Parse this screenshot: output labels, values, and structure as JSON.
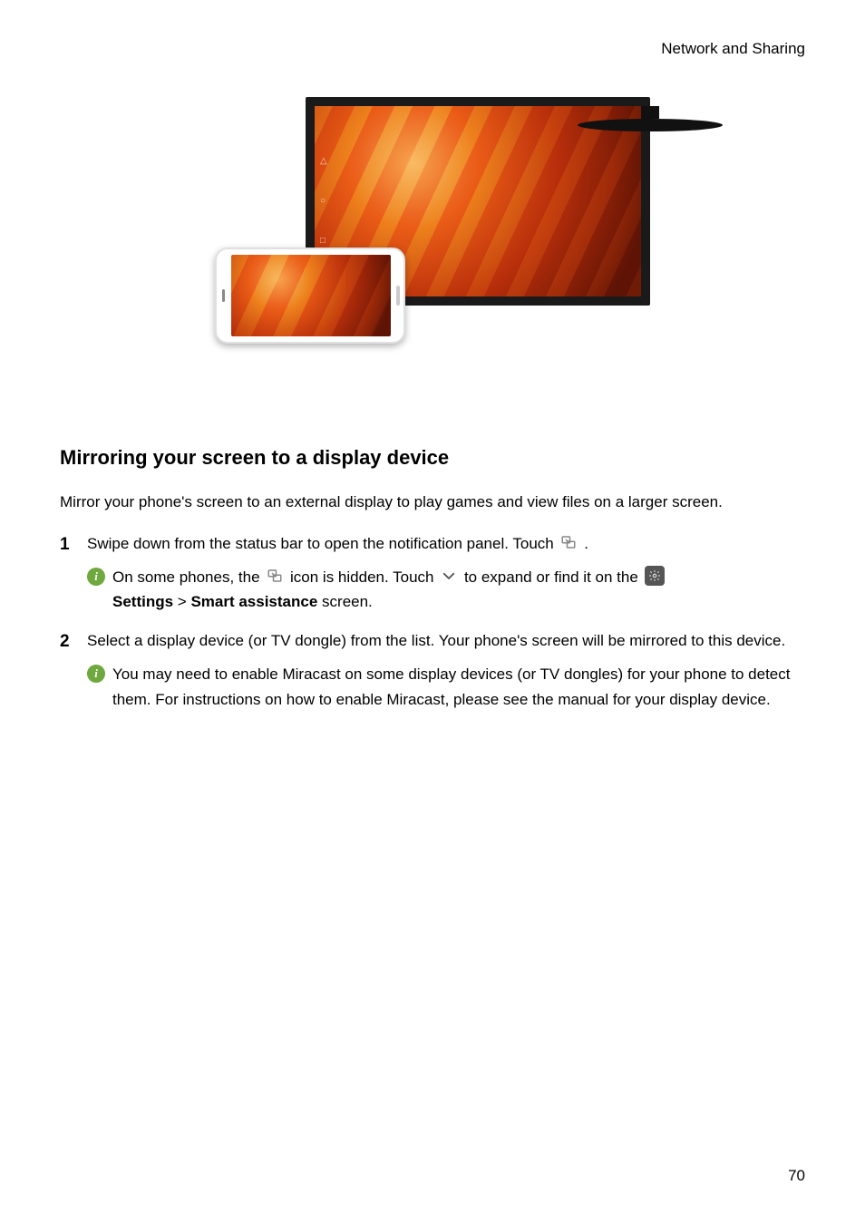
{
  "header": {
    "chapter": "Network and Sharing"
  },
  "section": {
    "title": "Mirroring your screen to a display device",
    "intro": "Mirror your phone's screen to an external display to play games and view files on a larger screen."
  },
  "steps": [
    {
      "num": "1",
      "text_before_icon": "Swipe down from the status bar to open the notification panel. Touch ",
      "text_after_icon": ".",
      "note": {
        "p1": "On some phones, the ",
        "p2": " icon is hidden. Touch ",
        "p3": " to expand or find it on the ",
        "bold1": "Settings",
        "sep": " > ",
        "bold2": "Smart assistance",
        "p4": " screen."
      }
    },
    {
      "num": "2",
      "text": "Select a display device (or TV dongle) from the list. Your phone's screen will be mirrored to this device.",
      "note": {
        "text": "You may need to enable Miracast on some display devices (or TV dongles) for your phone to detect them. For instructions on how to enable Miracast, please see the manual for your display device."
      }
    }
  ],
  "page_number": "70"
}
